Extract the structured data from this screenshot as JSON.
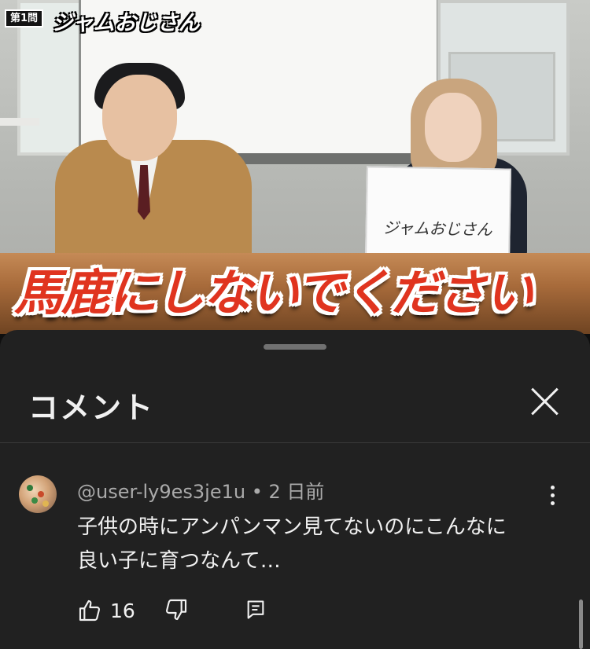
{
  "video": {
    "badge": "第1問",
    "episode_title": "ジャムおじさん",
    "caption": "馬鹿にしないでください",
    "sign_text": "ジャムおじさん"
  },
  "sheet": {
    "title": "コメント"
  },
  "comment": {
    "author": "@user-ly9es3je1u",
    "separator": "•",
    "time": "2 日前",
    "text_line1": "子供の時にアンパンマン見てないのにこんなに",
    "text_line2": "良い子に育つなんて…",
    "like_count": "16"
  },
  "icons": {
    "close": "close-icon",
    "more": "more-vert-icon",
    "like": "thumb-up-icon",
    "dislike": "thumb-down-icon",
    "reply": "reply-icon"
  }
}
